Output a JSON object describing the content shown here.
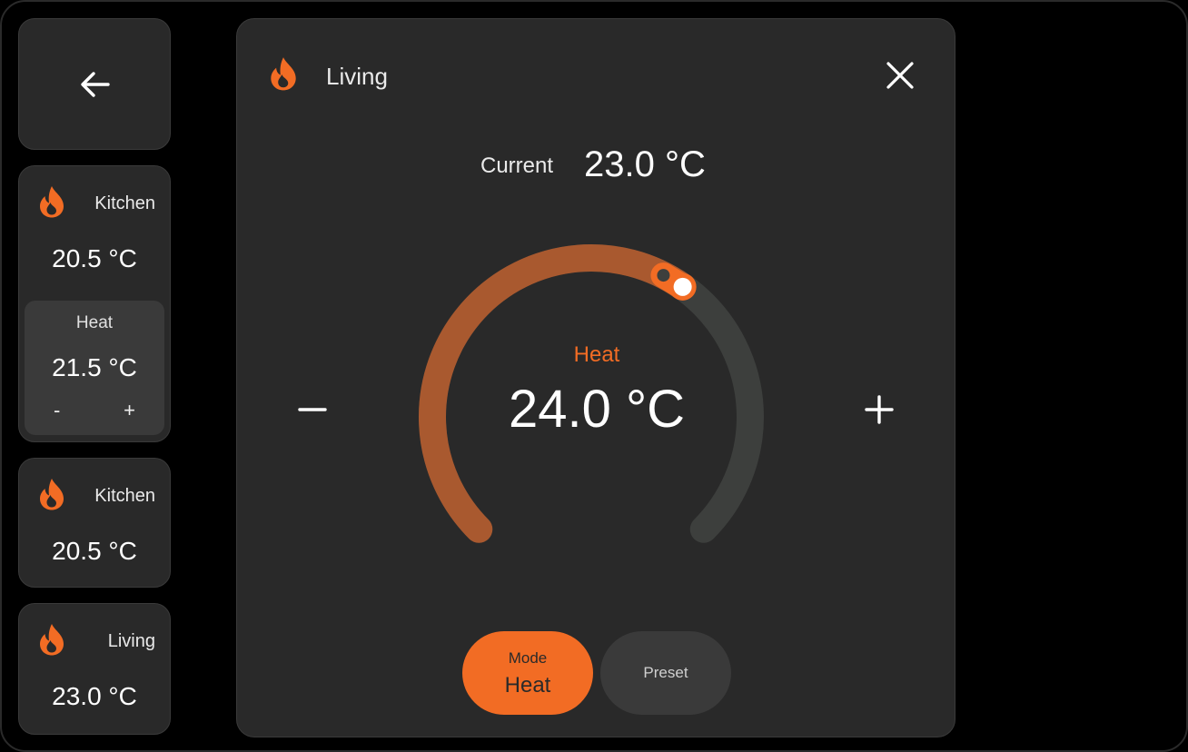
{
  "colors": {
    "accent": "#f26c24",
    "track": "#3d3f3d",
    "arc": "#a9592f"
  },
  "sidebar": {
    "back_icon": "arrow-left-icon",
    "tiles": [
      {
        "name": "Kitchen",
        "temp": "20.5 °C",
        "icon": "flame-icon",
        "control": {
          "mode": "Heat",
          "setpoint": "21.5 °C",
          "minus": "-",
          "plus": "+"
        }
      },
      {
        "name": "Kitchen",
        "temp": "20.5 °C",
        "icon": "flame-icon"
      },
      {
        "name": "Living",
        "temp": "23.0 °C",
        "icon": "flame-icon"
      }
    ]
  },
  "panel": {
    "title": "Living",
    "icon": "flame-icon",
    "close_icon": "close-icon",
    "current_label": "Current",
    "current_value": "23.0 °C",
    "dial": {
      "mode_label": "Heat",
      "setpoint": "24.0 °C",
      "fill_fraction": 0.63,
      "current_fraction": 0.6
    },
    "minus_icon": "minus-icon",
    "plus_icon": "plus-icon",
    "mode_button": {
      "label": "Mode",
      "value": "Heat"
    },
    "preset_button": {
      "label": "Preset"
    }
  }
}
